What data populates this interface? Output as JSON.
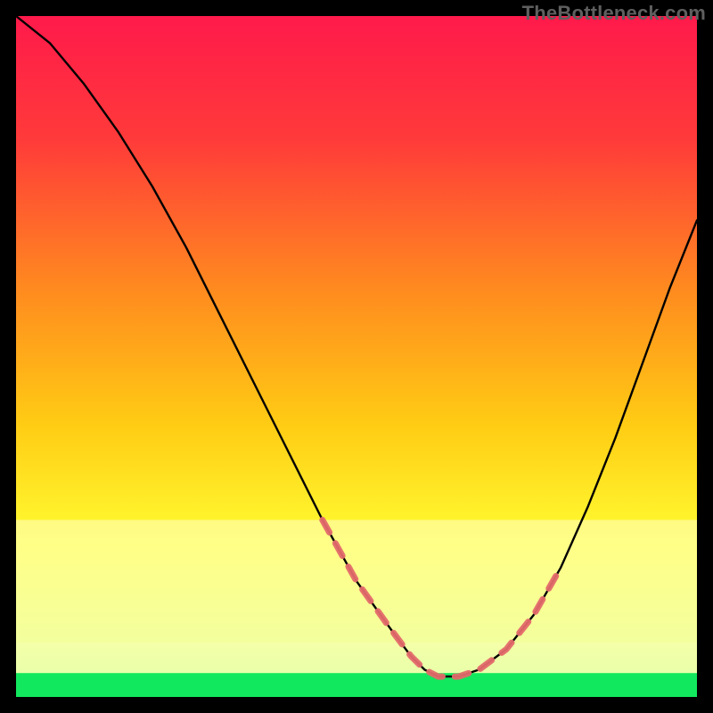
{
  "watermark": "TheBottleneck.com",
  "chart_data": {
    "type": "line",
    "title": "",
    "xlabel": "",
    "ylabel": "",
    "xlim": [
      0,
      100
    ],
    "ylim": [
      0,
      100
    ],
    "series": [
      {
        "name": "curve",
        "x": [
          0,
          5,
          10,
          15,
          20,
          25,
          30,
          35,
          40,
          45,
          50,
          55,
          58,
          60,
          62,
          65,
          68,
          72,
          76,
          80,
          84,
          88,
          92,
          96,
          100
        ],
        "y": [
          100,
          96,
          90,
          83,
          75,
          66,
          56,
          46,
          36,
          26,
          17,
          10,
          6,
          4,
          3,
          3,
          4,
          7,
          12,
          19,
          28,
          38,
          49,
          60,
          70
        ]
      }
    ],
    "highlight_thresholds": {
      "faint_band_above": 26,
      "bright_band_above": 8,
      "green_band_above": 3.5
    },
    "gradient_stops": [
      {
        "pos": 0.0,
        "color": "#ff1a4b"
      },
      {
        "pos": 0.18,
        "color": "#ff3a3a"
      },
      {
        "pos": 0.4,
        "color": "#ff8a1f"
      },
      {
        "pos": 0.6,
        "color": "#ffcc14"
      },
      {
        "pos": 0.78,
        "color": "#ffff33"
      },
      {
        "pos": 0.92,
        "color": "#e4ff66"
      },
      {
        "pos": 1.0,
        "color": "#1bff66"
      }
    ]
  }
}
